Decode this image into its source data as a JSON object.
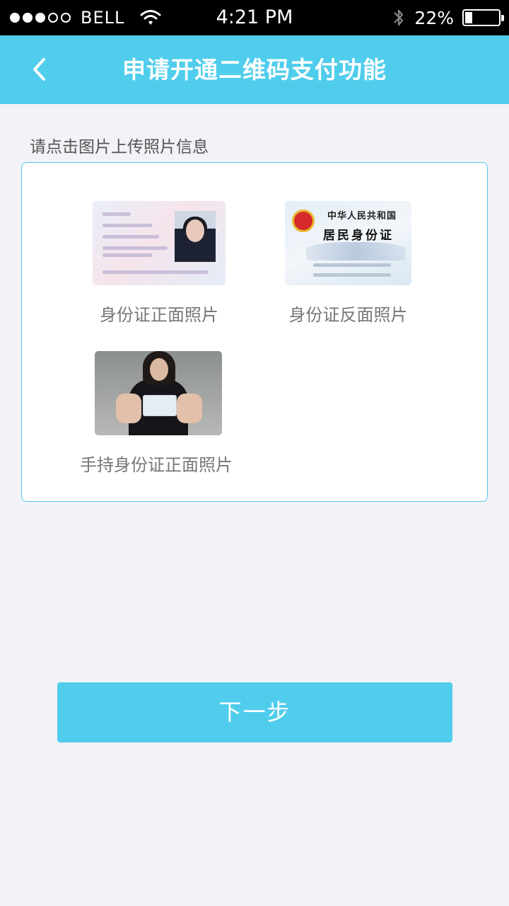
{
  "status_bar": {
    "carrier": "BELL",
    "signal_bars_filled": 3,
    "signal_bars_total": 5,
    "time": "4:21 PM",
    "battery_percent": "22%",
    "battery_level": 0.22,
    "icons": [
      "wifi-icon",
      "bluetooth-icon",
      "battery-icon"
    ]
  },
  "nav": {
    "title": "申请开通二维码支付功能",
    "back_icon": "chevron-left-icon"
  },
  "hint": "请点击图片上传照片信息",
  "uploads": [
    {
      "label": "身份证正面照片",
      "image": "id-card-front"
    },
    {
      "label": "身份证反面照片",
      "image": "id-card-back"
    },
    {
      "label": "手持身份证正面照片",
      "image": "holding-id-card-photo"
    }
  ],
  "id_back_text": {
    "country": "中华人民共和国",
    "card_name": "居民身份证"
  },
  "next_button": "下一步",
  "colors": {
    "accent": "#50cdec",
    "background": "#f2f2f7",
    "card_border": "#4fc8e6"
  }
}
